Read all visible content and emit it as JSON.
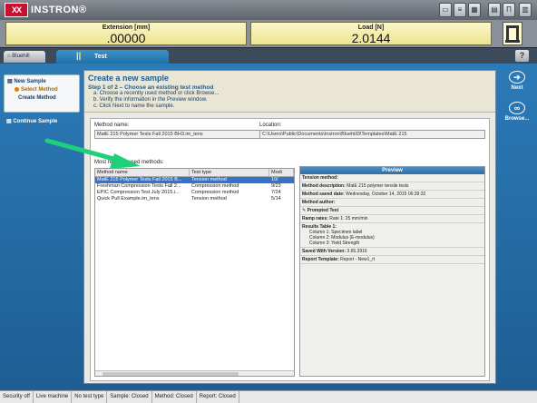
{
  "app": {
    "logo_mark": "XX",
    "name": "INSTRON",
    "reg": "®"
  },
  "toolbar": {
    "icons": [
      "window-icon",
      "list-icon",
      "calc-icon",
      "panel-icon",
      "machine-icon",
      "chart-icon"
    ]
  },
  "readouts": {
    "extension": {
      "label": "Extension [mm]",
      "value": ".00000"
    },
    "load": {
      "label": "Load [N]",
      "value": "2.0144"
    }
  },
  "tabs": {
    "home": "Bluehill",
    "test": "Test"
  },
  "help": "?",
  "leftnav": {
    "new_sample": "New Sample",
    "select_method": "Select Method",
    "create_method": "Create Method",
    "continue_sample": "Continue Sample"
  },
  "header": {
    "title": "Create a new sample",
    "step": "Step 1 of 2 – Choose an existing test method",
    "instructions": [
      "a. Choose a recently used method or click Browse...",
      "b. Verify the information in the Preview window.",
      "c. Click Next to name the sample."
    ]
  },
  "fields": {
    "method_name_label": "Method name:",
    "method_name_value": "MatE 215 Polymer Tests Fall 2015 BH3.im_tens",
    "location_label": "Location:",
    "location_value": "C:\\Users\\Public\\Documents\\Instron\\Bluehill3\\Templates\\MatE 215"
  },
  "mru": {
    "label": "Most recently used methods:",
    "columns": [
      "Method name",
      "Test type",
      "Modi"
    ],
    "rows": [
      [
        "MatE 215 Polymer Tests Fall 2015 B...",
        "Tension method",
        "10/"
      ],
      [
        "Freshman Compression Tests Fall 2...",
        "Compression method",
        "9/23"
      ],
      [
        "EPIC Compression Test July 2015.i...",
        "Compression method",
        "7/24"
      ],
      [
        "Quick Pull Example.im_tens",
        "Tension method",
        "5/14"
      ]
    ]
  },
  "preview": {
    "title": "Preview",
    "tension_method": "Tension method:",
    "desc_label": "Method description:",
    "desc_value": "MatE 215 polymer tensile tests",
    "saved_label": "Method saved date:",
    "saved_value": "Wednesday, October 14, 2015 06:39:32",
    "author_label": "Method author:",
    "prompted": "Prompted Test",
    "ramp_label": "Ramp rates:",
    "ramp_value": "Rate 1: 25 mm/min",
    "results_label": "Results Table 1:",
    "results": [
      "Column 1: Specimen label",
      "Column 2: Modulus (E-modulus)",
      "Column 3: Yield Strength"
    ],
    "version_label": "Saved With Version:",
    "version_value": "3.65.3916",
    "template_label": "Report Template:",
    "template_value": "Report - New1_rt"
  },
  "rightnav": {
    "next": "Next",
    "browse": "Browse..."
  },
  "statusbar": [
    "Security off",
    "Live machine",
    "No test type",
    "Sample: Closed",
    "Method: Closed",
    "Report: Closed"
  ],
  "colors": {
    "accent": "#2c7ab7",
    "selection": "#3572c9",
    "readout": "#fbf6c9",
    "arrow": "#1fd07a"
  }
}
